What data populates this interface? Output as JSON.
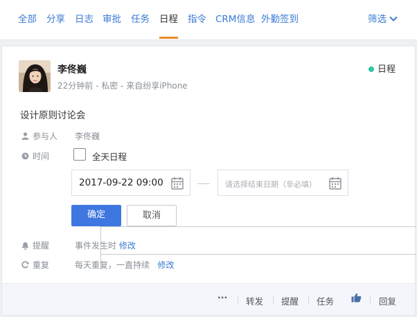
{
  "tabs": {
    "items": [
      {
        "label": "全部"
      },
      {
        "label": "分享"
      },
      {
        "label": "日志"
      },
      {
        "label": "审批"
      },
      {
        "label": "任务"
      },
      {
        "label": "日程"
      },
      {
        "label": "指令"
      },
      {
        "label": "CRM信息"
      },
      {
        "label": "外勤签到"
      }
    ],
    "active": "日程",
    "filter_label": "筛选"
  },
  "post": {
    "author": "李佟巍",
    "meta": "22分钟前 - 私密 - 来自纷享iPhone",
    "type_badge": "日程",
    "badge_color": "#2ec4a6",
    "title": "设计原则讨论会"
  },
  "schedule": {
    "participants_label": "参与人",
    "participants_value": "李佟巍",
    "time_label": "时间",
    "all_day_label": "全天日程",
    "all_day_checked": false,
    "start_datetime": "2017-09-22   09:00",
    "end_placeholder": "请选择结束日期（非必填）",
    "confirm_label": "确定",
    "cancel_label": "取消",
    "reminder_label": "提醒",
    "reminder_value": "事件发生时",
    "reminder_edit": "修改",
    "repeat_label": "重复",
    "repeat_value": "每天重复，一直持续",
    "repeat_edit": "修改"
  },
  "footer": {
    "more": "···",
    "forward": "转发",
    "remind": "提醒",
    "task": "任务",
    "like_icon": "thumbs-up-icon",
    "reply": "回复"
  },
  "colors": {
    "link": "#3a7bd5",
    "active_tab_underline": "#f08a24",
    "primary_button": "#3f77e0"
  }
}
